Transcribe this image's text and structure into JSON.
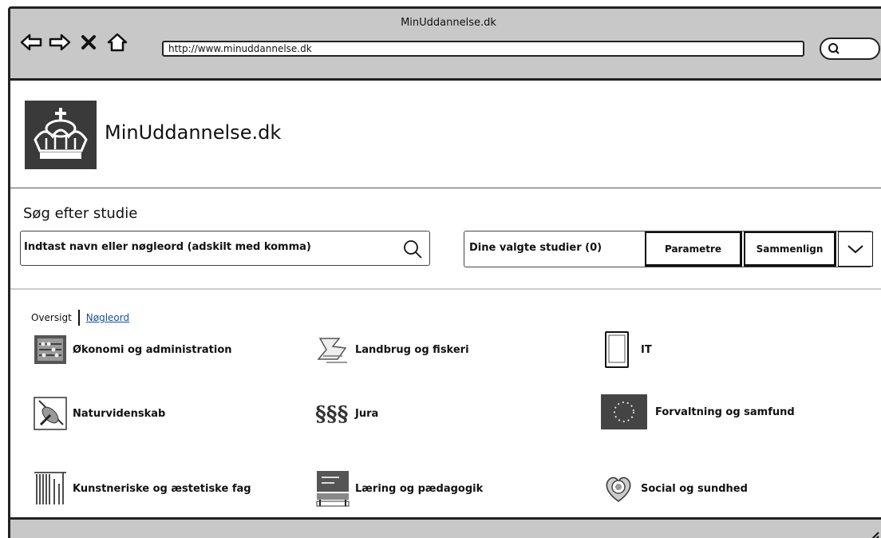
{
  "browser": {
    "window_title": "MinUddannelse.dk",
    "url": "http://www.minuddannelse.dk"
  },
  "header": {
    "site_name": "MinUddannelse.dk"
  },
  "search": {
    "heading": "Søg efter studie",
    "placeholder": "Indtast navn eller nøgleord (adskilt med komma)"
  },
  "compare": {
    "selected_label": "Dine valgte studier (0)",
    "params_button": "Parametre",
    "compare_button": "Sammenlign"
  },
  "tabs": {
    "overview": "Oversigt",
    "keywords": "Nøgleord"
  },
  "categories": [
    {
      "label": "Økonomi og administration",
      "icon": "abacus-icon"
    },
    {
      "label": "Landbrug og fiskeri",
      "icon": "landscape-icon"
    },
    {
      "label": "IT",
      "icon": "tablet-icon"
    },
    {
      "label": "Naturvidenskab",
      "icon": "science-icon"
    },
    {
      "label": "Jura",
      "icon": "paragraph-icon"
    },
    {
      "label": "Forvaltning og samfund",
      "icon": "eu-stars-icon"
    },
    {
      "label": "Kunstneriske og æstetiske fag",
      "icon": "columns-icon"
    },
    {
      "label": "Læring og pædagogik",
      "icon": "desk-icon"
    },
    {
      "label": "Social og sundhed",
      "icon": "heart-icon"
    }
  ]
}
